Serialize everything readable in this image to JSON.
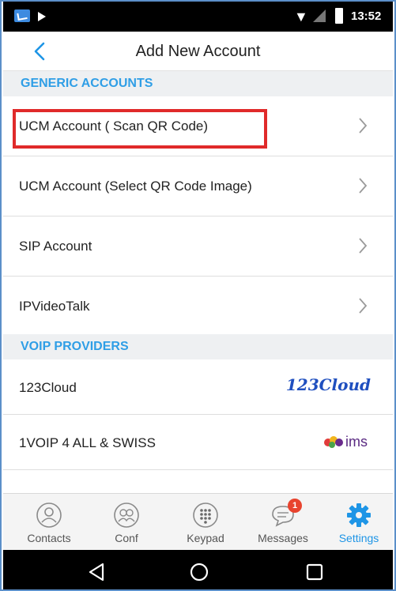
{
  "status_bar": {
    "time": "13:52"
  },
  "app_bar": {
    "title": "Add New Account"
  },
  "sections": {
    "generic_title": "GENERIC ACCOUNTS",
    "voip_title": "VOIP PROVIDERS"
  },
  "generic_accounts": [
    {
      "label": "UCM Account ( Scan QR Code)"
    },
    {
      "label": "UCM Account (Select QR Code Image)"
    },
    {
      "label": "SIP Account"
    },
    {
      "label": "IPVideoTalk"
    }
  ],
  "voip_providers": [
    {
      "label": "123Cloud",
      "logo_text": "123Cloud"
    },
    {
      "label": "1VOIP 4 ALL & SWISS",
      "logo_text": "ims"
    }
  ],
  "bottom_nav": {
    "tabs": [
      {
        "label": "Contacts",
        "icon": "contacts-icon"
      },
      {
        "label": "Conf",
        "icon": "conference-icon"
      },
      {
        "label": "Keypad",
        "icon": "keypad-icon"
      },
      {
        "label": "Messages",
        "icon": "messages-icon",
        "badge": "1"
      },
      {
        "label": "Settings",
        "icon": "gear-icon",
        "active": true
      }
    ]
  },
  "colors": {
    "accent": "#1e95e6",
    "highlight": "#e02a2a",
    "badge": "#e8432e"
  }
}
